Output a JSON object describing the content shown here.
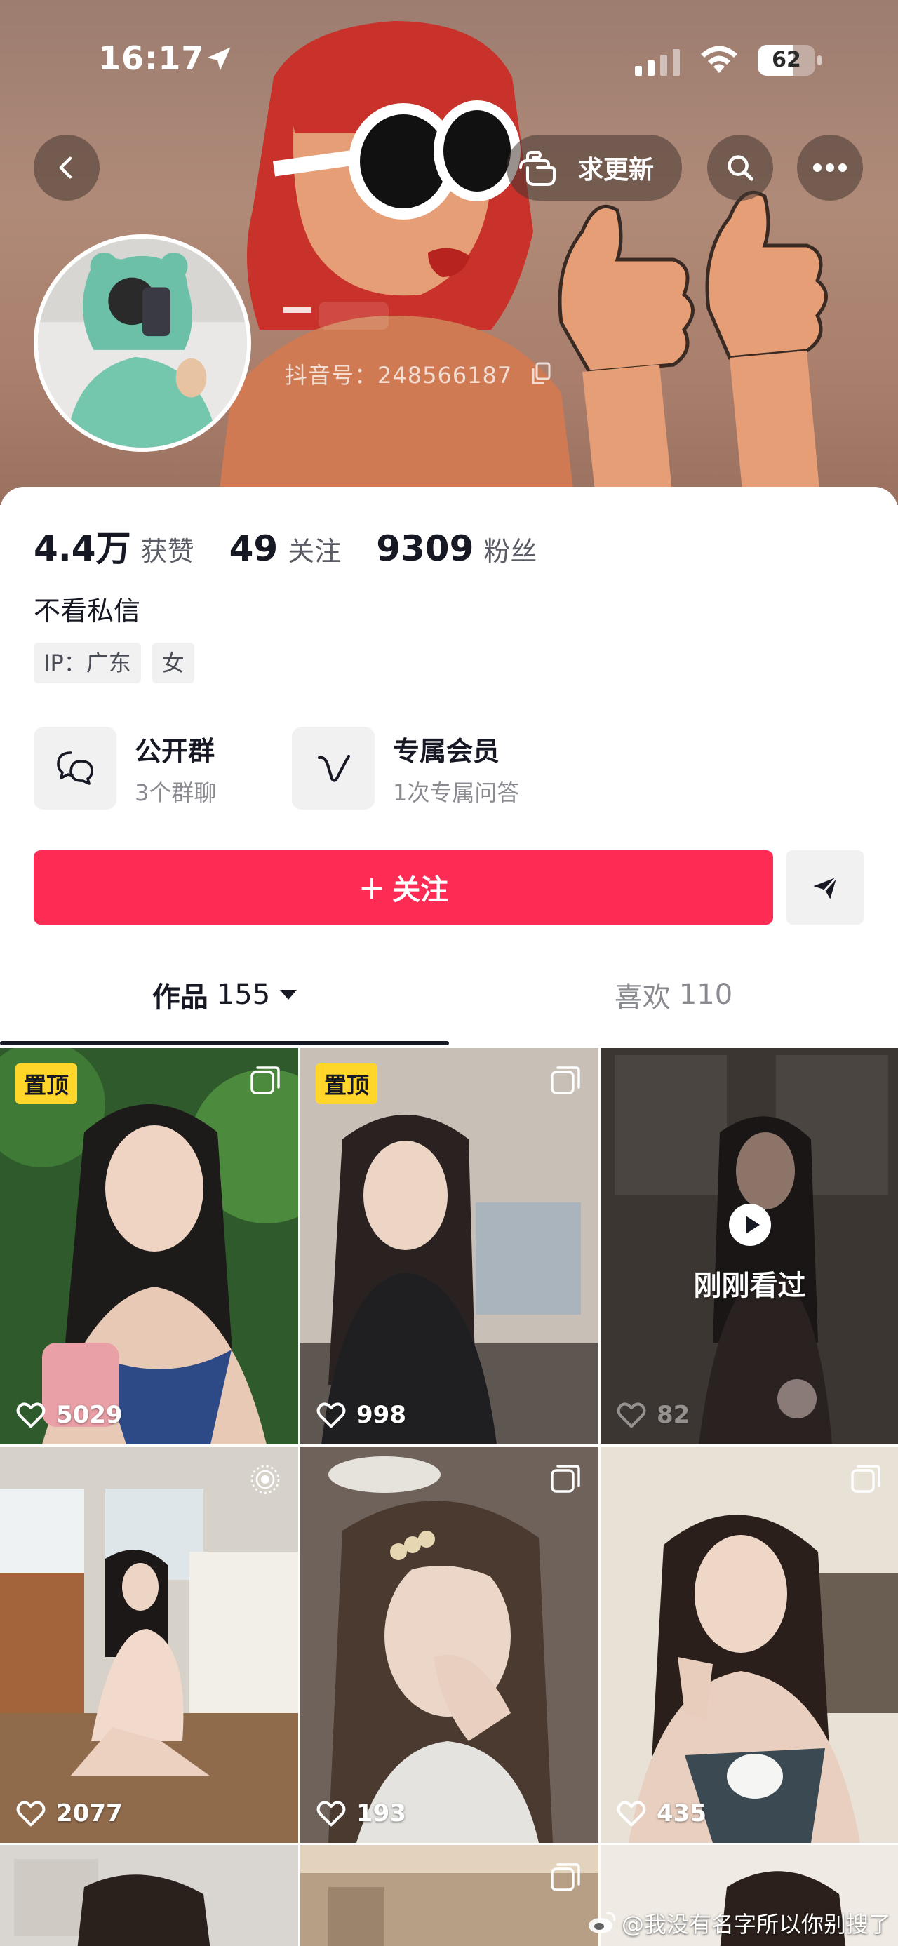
{
  "status_bar": {
    "time": "16:17",
    "battery": "62",
    "battery_level": 0.62
  },
  "header": {
    "update_label": "求更新",
    "douyin_id": "抖音号：248566187"
  },
  "stats": [
    {
      "value": "4.4万",
      "label": "获赞"
    },
    {
      "value": "49",
      "label": "关注"
    },
    {
      "value": "9309",
      "label": "粉丝"
    }
  ],
  "bio": "不看私信",
  "tags": [
    "IP：广东",
    "女"
  ],
  "features": {
    "group": {
      "title": "公开群",
      "subtitle": "3个群聊"
    },
    "member": {
      "title": "专属会员",
      "subtitle": "1次专属问答"
    }
  },
  "follow": {
    "plus": "+",
    "label": "关注"
  },
  "tabs": {
    "works": {
      "label": "作品",
      "count": "155"
    },
    "likes": {
      "label": "喜欢",
      "count": "110"
    }
  },
  "videos": [
    {
      "likes": "5029",
      "pinned": "置顶"
    },
    {
      "likes": "998",
      "pinned": "置顶"
    },
    {
      "likes": "82",
      "watched": "刚刚看过"
    },
    {
      "likes": "2077"
    },
    {
      "likes": "193"
    },
    {
      "likes": "435"
    }
  ],
  "watermark": "@我没有名字所以你别搜了",
  "colors": {
    "accent": "#fe2c55",
    "pin_badge": "#ffd629",
    "text": "#161823",
    "muted": "#8a8b91"
  }
}
